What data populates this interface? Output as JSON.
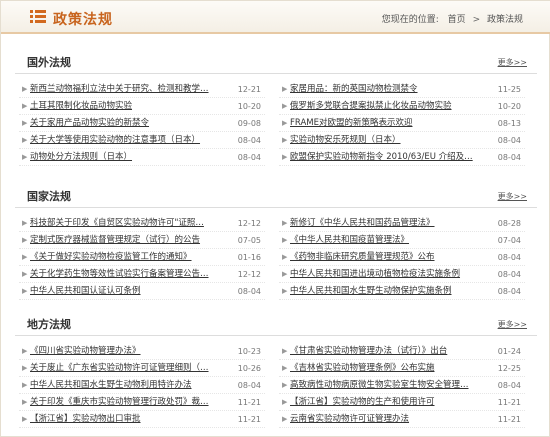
{
  "header": {
    "title": "政策法规",
    "location_label": "您现在的位置:",
    "home": "首页",
    "separator": ">",
    "current": "政策法规"
  },
  "sections": [
    {
      "title": "国外法规",
      "more": "更多>>",
      "left": [
        {
          "text": "新西兰动物福利立法中关于研究、检测和教学…",
          "date": "12-21"
        },
        {
          "text": "土耳其限制化妆品动物实验",
          "date": "10-20"
        },
        {
          "text": "关于家用产品动物实验的新禁令",
          "date": "09-08"
        },
        {
          "text": "关于大学等使用实验动物的注意事项（日本）",
          "date": "08-04"
        },
        {
          "text": "动物处分方法规则（日本）",
          "date": "08-04"
        }
      ],
      "right": [
        {
          "text": "家居用品：新的英国动物检测禁令",
          "date": "11-25"
        },
        {
          "text": "俄罗斯多党联合提案拟禁止化妆品动物实验",
          "date": "10-20"
        },
        {
          "text": "FRAME对欧盟的新策略表示欢迎",
          "date": "08-13"
        },
        {
          "text": "实验动物安乐死规则（日本）",
          "date": "08-04"
        },
        {
          "text": "欧盟保护实验动物新指令 2010/63/EU 介绍及…",
          "date": "08-04"
        }
      ]
    },
    {
      "title": "国家法规",
      "more": "更多>>",
      "left": [
        {
          "text": "科技部关于印发《自贸区实验动物许可\"证照…",
          "date": "12-12"
        },
        {
          "text": "定制式医疗器械监督管理规定（试行）的公告",
          "date": "07-05"
        },
        {
          "text": "《关于做好实验动物检疫监管工作的通知》",
          "date": "01-16"
        },
        {
          "text": "关于化学药生物等效性试验实行备案管理公告…",
          "date": "12-12"
        },
        {
          "text": "中华人民共和国认证认可条例",
          "date": "08-04"
        }
      ],
      "right": [
        {
          "text": "新修订《中华人民共和国药品管理法》",
          "date": "08-28"
        },
        {
          "text": "《中华人民共和国疫苗管理法》",
          "date": "07-04"
        },
        {
          "text": "《药物非临床研究质量管理规范》公布",
          "date": "08-04"
        },
        {
          "text": "中华人民共和国进出境动植物检疫法实施条例",
          "date": "08-04"
        },
        {
          "text": "中华人民共和国水生野生动物保护实施条例",
          "date": "08-04"
        }
      ]
    },
    {
      "title": "地方法规",
      "more": "更多>>",
      "left": [
        {
          "text": "《四川省实验动物管理办法》",
          "date": "10-23"
        },
        {
          "text": "关于废止《广东省实验动物许可证管理细则（…",
          "date": "10-26"
        },
        {
          "text": "中华人民共和国水生野生动物利用特许办法",
          "date": "08-04"
        },
        {
          "text": "关于印发《重庆市实验动物管理行政处罚》裁…",
          "date": "11-21"
        },
        {
          "text": "【浙江省】实验动物出口审批",
          "date": "11-21"
        }
      ],
      "right": [
        {
          "text": "《甘肃省实验动物管理办法（试行）》出台",
          "date": "01-24"
        },
        {
          "text": "《吉林省实验动物管理条例》公布实施",
          "date": "12-25"
        },
        {
          "text": "高致病性动物病原微生物实验室生物安全管理…",
          "date": "08-04"
        },
        {
          "text": "【浙江省】实验动物的生产和使用许可",
          "date": "11-21"
        },
        {
          "text": "云南省实验动物许可证管理办法",
          "date": "11-21"
        }
      ]
    }
  ]
}
